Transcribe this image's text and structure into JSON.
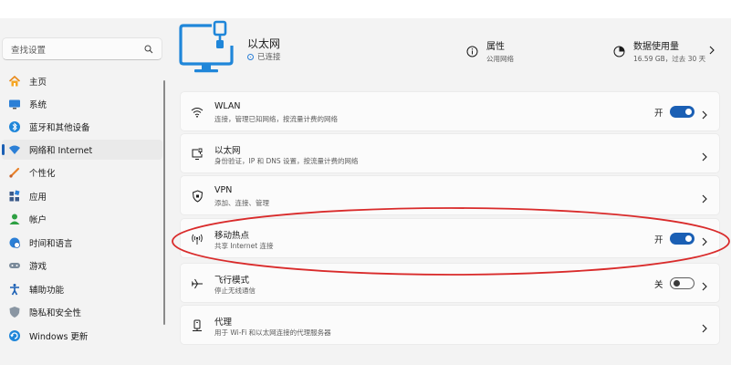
{
  "colors": {
    "accent": "#1a5fb4",
    "monitor_icon": "#1f86d9",
    "annotation_circle": "#d92b2b",
    "panel_bg": "#f3f3f3",
    "card_bg": "#fbfbfb"
  },
  "search": {
    "placeholder": "查找设置",
    "icon": "search-icon"
  },
  "sidebar": {
    "items": [
      {
        "label": "主页",
        "icon": "home-icon"
      },
      {
        "label": "系统",
        "icon": "monitor-icon"
      },
      {
        "label": "蓝牙和其他设备",
        "icon": "bluetooth-icon"
      },
      {
        "label": "网络和 Internet",
        "icon": "wifi-icon",
        "active": true
      },
      {
        "label": "个性化",
        "icon": "brush-icon"
      },
      {
        "label": "应用",
        "icon": "apps-icon"
      },
      {
        "label": "帐户",
        "icon": "person-icon"
      },
      {
        "label": "时间和语言",
        "icon": "globe-clock-icon"
      },
      {
        "label": "游戏",
        "icon": "gamepad-icon"
      },
      {
        "label": "辅助功能",
        "icon": "accessibility-icon"
      },
      {
        "label": "隐私和安全性",
        "icon": "shield-icon"
      },
      {
        "label": "Windows 更新",
        "icon": "update-icon"
      }
    ]
  },
  "header": {
    "title": "以太网",
    "status": "已连接",
    "properties": {
      "title": "属性",
      "subtitle": "公用网络",
      "icon": "info-icon"
    },
    "data_usage": {
      "title": "数据使用量",
      "subtitle": "16.59 GB，过去 30 天",
      "icon": "data-usage-icon"
    }
  },
  "cards": [
    {
      "title": "WLAN",
      "subtitle": "连接，管理已知网络，按流量计费的网络",
      "icon": "wifi-icon",
      "toggle_label": "开",
      "toggle_on": true
    },
    {
      "title": "以太网",
      "subtitle": "身份验证，IP 和 DNS 设置，按流量计费的网络",
      "icon": "ethernet-icon"
    },
    {
      "title": "VPN",
      "subtitle": "添加、连接、管理",
      "icon": "vpn-shield-icon"
    },
    {
      "title": "移动热点",
      "subtitle": "共享 Internet 连接",
      "icon": "hotspot-icon",
      "toggle_label": "开",
      "toggle_on": true
    },
    {
      "title": "飞行模式",
      "subtitle": "停止无线通信",
      "icon": "airplane-icon",
      "toggle_label": "关",
      "toggle_on": false
    },
    {
      "title": "代理",
      "subtitle": "用于 Wi-Fi 和以太网连接的代理服务器",
      "icon": "proxy-icon"
    }
  ]
}
